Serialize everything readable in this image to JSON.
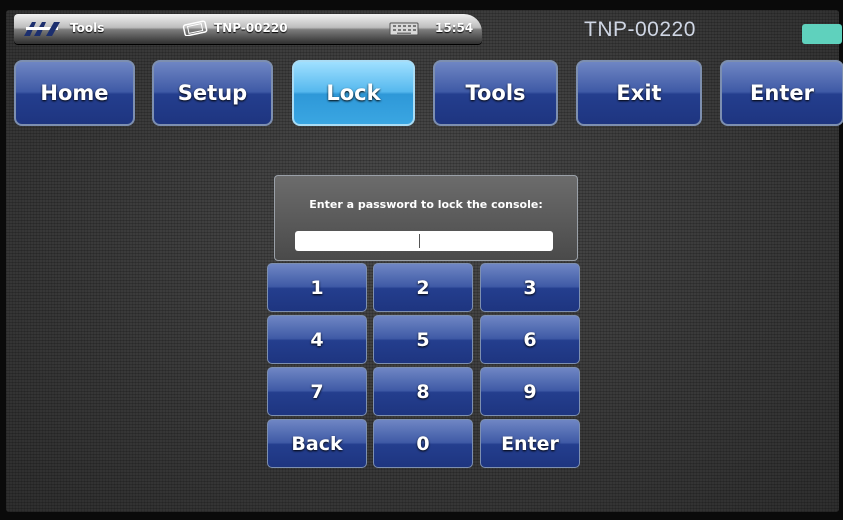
{
  "status_bar": {
    "app_name": "Tools",
    "device_name": "TNP-00220",
    "time": "15:54"
  },
  "header": {
    "title": "TNP-00220",
    "indicator_color": "#5fd1bd"
  },
  "nav": {
    "active": "Lock",
    "buttons": [
      "Home",
      "Setup",
      "Lock",
      "Tools",
      "Exit",
      "Enter"
    ]
  },
  "lock_panel": {
    "prompt": "Enter a password to lock the console:",
    "password_value": ""
  },
  "keypad": {
    "keys": [
      "1",
      "2",
      "3",
      "4",
      "5",
      "6",
      "7",
      "8",
      "9",
      "Back",
      "0",
      "Enter"
    ]
  },
  "colors": {
    "button_blue": "#2a4596",
    "button_active": "#3aa6e2"
  },
  "icons": {
    "logo": "amx-logo-icon",
    "device": "touch-panel-icon",
    "keyboard": "keyboard-icon"
  }
}
